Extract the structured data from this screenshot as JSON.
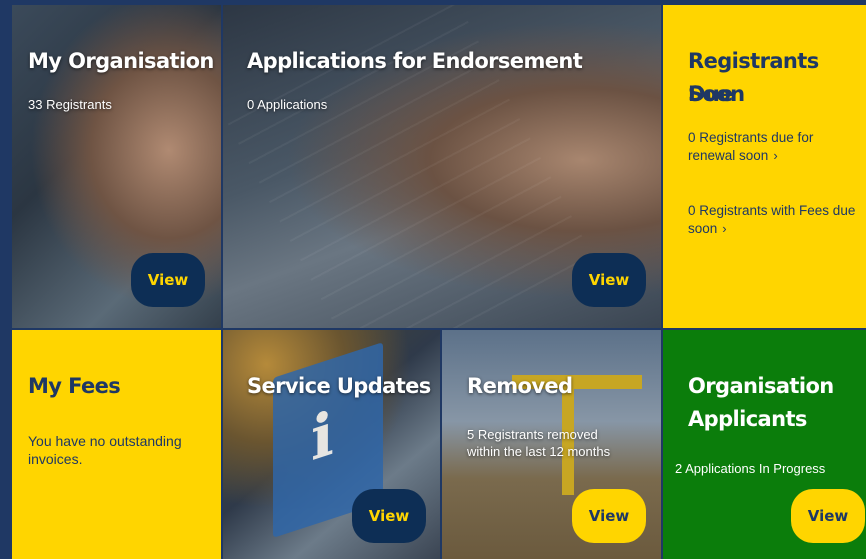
{
  "tiles": {
    "organisation": {
      "title": "My Organisation",
      "summary": "33 Registrants",
      "button": "View"
    },
    "endorsement": {
      "title": "Applications for Endorsement",
      "summary": "0 Applications",
      "button": "View"
    },
    "due_soon": {
      "title_line1": "Registrants Due",
      "title_line2": "Soon",
      "renewal_link": "0 Registrants due for renewal soon",
      "fees_link": "0 Registrants with Fees due soon",
      "chevron": "›"
    },
    "fees": {
      "title": "My Fees",
      "message": "You have no outstanding invoices."
    },
    "service_updates": {
      "title": "Service Updates",
      "sign_glyph": "i",
      "button": "View"
    },
    "removed": {
      "title": "Removed",
      "summary": "5 Registrants removed within the last 12 months",
      "button": "View"
    },
    "applicants": {
      "title_line1": "Organisation",
      "title_line2": "Applicants",
      "summary": "2 Applications In Progress",
      "button": "View"
    }
  },
  "colors": {
    "navy": "#1f3864",
    "yellow": "#ffd500",
    "green": "#0b7d0b",
    "button_dark": "#0d2e55"
  }
}
